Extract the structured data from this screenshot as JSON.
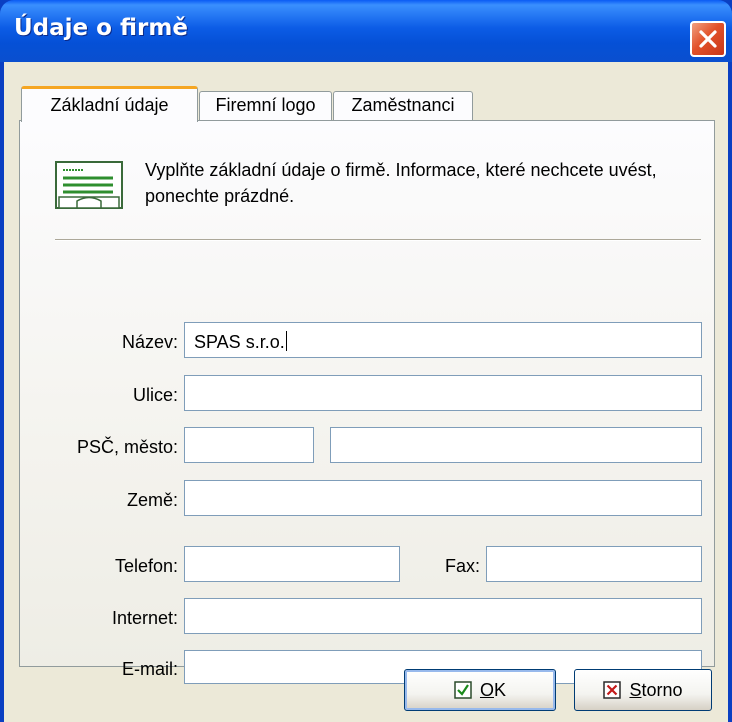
{
  "window": {
    "title": "Údaje o firmě"
  },
  "tabs": [
    {
      "label": "Základní údaje",
      "active": true
    },
    {
      "label": "Firemní logo",
      "active": false
    },
    {
      "label": "Zaměstnanci",
      "active": false
    }
  ],
  "info": {
    "text": "Vyplňte základní údaje o firmě. Informace, které nechcete uvést, ponechte prázdné.",
    "icon": "address-card-icon"
  },
  "form": {
    "nazev": {
      "label": "Název:",
      "value": "SPAS s.r.o."
    },
    "ulice": {
      "label": "Ulice:",
      "value": ""
    },
    "psc_mesto": {
      "label": "PSČ, město:",
      "psc": "",
      "mesto": ""
    },
    "zeme": {
      "label": "Země:",
      "value": ""
    },
    "telefon": {
      "label": "Telefon:",
      "value": ""
    },
    "fax": {
      "label": "Fax:",
      "value": ""
    },
    "internet": {
      "label": "Internet:",
      "value": ""
    },
    "email": {
      "label": "E-mail:",
      "value": ""
    }
  },
  "buttons": {
    "ok": {
      "accel": "O",
      "rest": "K"
    },
    "storno": {
      "accel": "S",
      "rest": "torno"
    }
  },
  "colors": {
    "titlebar": "#0a5bf4",
    "client": "#ece9d8",
    "close": "#e2522a"
  }
}
